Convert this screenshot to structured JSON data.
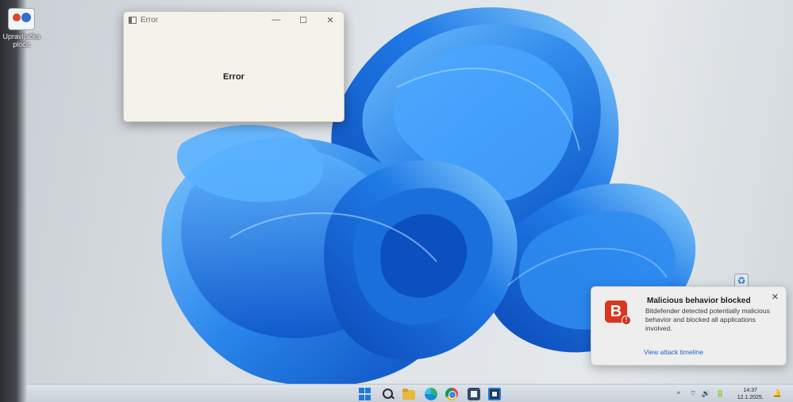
{
  "desktop": {
    "icon_label": "Upravljačka ploča",
    "recycle_icon": "recycle-bin-icon"
  },
  "error_window": {
    "title": "Error",
    "message": "Error",
    "controls": {
      "minimize": "—",
      "maximize": "☐",
      "close": "✕"
    }
  },
  "toast": {
    "title": "Malicious behavior blocked",
    "body": "Bitdefender detected potentially malicious behavior and blocked all applications involved.",
    "link": "View attack timeline",
    "logo_letter": "B",
    "badge": "!",
    "close": "✕"
  },
  "taskbar": {
    "icons": [
      "start-icon",
      "search-icon",
      "file-explorer-icon",
      "edge-icon",
      "chrome-icon",
      "store-icon",
      "app-icon"
    ],
    "tray": {
      "chevron": "^",
      "system_icons": "⌔ 🔊 🔋",
      "time": "14:37",
      "date": "12.1.2025.",
      "notification_icon": "🔔"
    }
  },
  "colors": {
    "accent": "#1f63c6",
    "bitdefender_red": "#d8381f",
    "wallpaper_blue": "#1e78e0"
  }
}
